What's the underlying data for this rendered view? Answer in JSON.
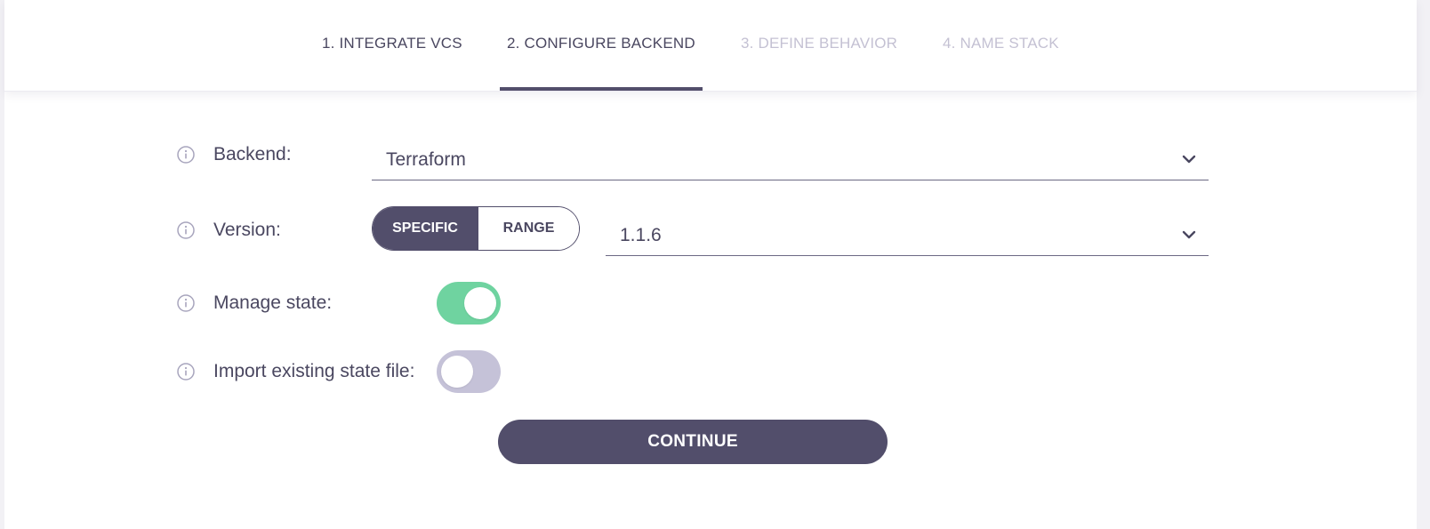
{
  "steps": [
    {
      "label": "1. INTEGRATE VCS",
      "state": "done"
    },
    {
      "label": "2. CONFIGURE BACKEND",
      "state": "active"
    },
    {
      "label": "3. DEFINE BEHAVIOR",
      "state": "todo"
    },
    {
      "label": "4. NAME STACK",
      "state": "todo"
    }
  ],
  "form": {
    "backend": {
      "label": "Backend:",
      "value": "Terraform"
    },
    "version": {
      "label": "Version:",
      "mode_specific": "SPECIFIC",
      "mode_range": "RANGE",
      "selected_mode": "SPECIFIC",
      "value": "1.1.6"
    },
    "manage_state": {
      "label": "Manage state:",
      "enabled": true
    },
    "import_state": {
      "label": "Import existing state file:",
      "enabled": false
    }
  },
  "actions": {
    "continue_label": "CONTINUE"
  },
  "colors": {
    "primary": "#524e6b",
    "toggle_on": "#6fd3a0",
    "toggle_off": "#c5c2d8",
    "step_inactive": "#c4c1d3"
  },
  "icons": {
    "info": "info-circle-icon",
    "dropdown": "chevron-down-icon"
  }
}
